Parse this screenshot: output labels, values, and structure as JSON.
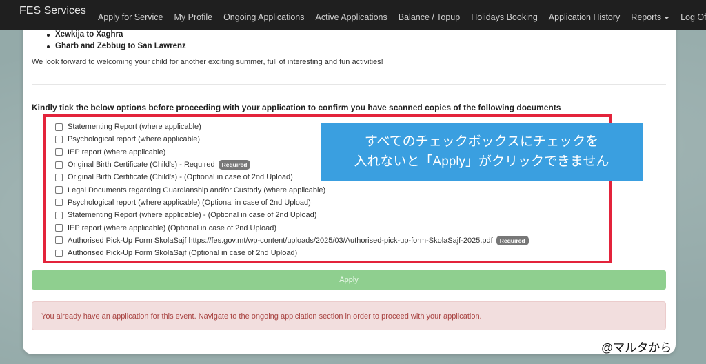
{
  "navbar": {
    "brand": "FES Services",
    "items": [
      {
        "label": "Apply for Service"
      },
      {
        "label": "My Profile"
      },
      {
        "label": "Ongoing Applications"
      },
      {
        "label": "Active Applications"
      },
      {
        "label": "Balance / Topup"
      },
      {
        "label": "Holidays Booking"
      },
      {
        "label": "Application History"
      },
      {
        "label": "Reports"
      },
      {
        "label": "Log Off"
      }
    ]
  },
  "content": {
    "bullets": [
      "Xewkija to Xaghra",
      "Gharb and Zebbug to San Lawrenz"
    ],
    "welcome_text": "We look forward to welcoming your child for another exciting summer, full of interesting and fun activities!",
    "tick_heading": "Kindly tick the below options before proceeding with your application to confirm you have scanned copies of the following documents",
    "options": [
      {
        "label": "Statementing Report (where applicable)",
        "badge": ""
      },
      {
        "label": "Psychological report (where applicable)",
        "badge": ""
      },
      {
        "label": "IEP report (where applicable)",
        "badge": ""
      },
      {
        "label": "Original Birth Certificate (Child's) - Required",
        "badge": "Required"
      },
      {
        "label": "Original Birth Certificate (Child's) - (Optional in case of 2nd Upload)",
        "badge": ""
      },
      {
        "label": "Legal Documents regarding Guardianship and/or Custody (where applicable)",
        "badge": ""
      },
      {
        "label": "Psychological report (where applicable) (Optional in case of 2nd Upload)",
        "badge": ""
      },
      {
        "label": "Statementing Report (where applicable) - (Optional in case of 2nd Upload)",
        "badge": ""
      },
      {
        "label": "IEP report (where applicable) (Optional in case of 2nd Upload)",
        "badge": ""
      },
      {
        "label": "Authorised Pick-Up Form SkolaSajf https://fes.gov.mt/wp-content/uploads/2025/03/Authorised-pick-up-form-SkolaSajf-2025.pdf",
        "badge": "Required"
      },
      {
        "label": "Authorised Pick-Up Form SkolaSajf (Optional in case of 2nd Upload)",
        "badge": ""
      }
    ],
    "apply_label": "Apply",
    "alert_text": "You already have an application for this event. Navigate to the ongoing applciation section in order to proceed with your application."
  },
  "annotation": {
    "line1": "すべてのチェックボックスにチェックを",
    "line2": "入れないと「Apply」がクリックできません",
    "watermark": "@マルタから"
  },
  "colors": {
    "navbar": "#1f1f1f",
    "highlight_frame": "#e3233b",
    "callout": "#3a9fe0",
    "apply_button": "#8fcf8f",
    "alert_bg": "#f2dede",
    "alert_text": "#a94442"
  }
}
